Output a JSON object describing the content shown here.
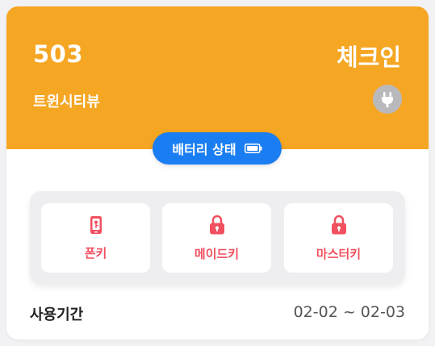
{
  "room": {
    "number": "503",
    "status": "체크인",
    "type": "트윈시티뷰"
  },
  "icons": {
    "power": "plug-icon",
    "battery": "battery-icon",
    "phone_key": "phone-key-icon",
    "maid_key": "lock-icon",
    "master_key": "lock-icon"
  },
  "battery": {
    "label": "배터리 상태"
  },
  "keys": [
    {
      "label": "폰키"
    },
    {
      "label": "메이드키"
    },
    {
      "label": "마스터키"
    }
  ],
  "period": {
    "label": "사용기간",
    "value": "02-02 ~ 02-03"
  },
  "colors": {
    "header": "#f5a623",
    "accent_blue": "#1a7ef2",
    "key_red": "#f0505f",
    "plug_gray": "#b9b9bd"
  }
}
